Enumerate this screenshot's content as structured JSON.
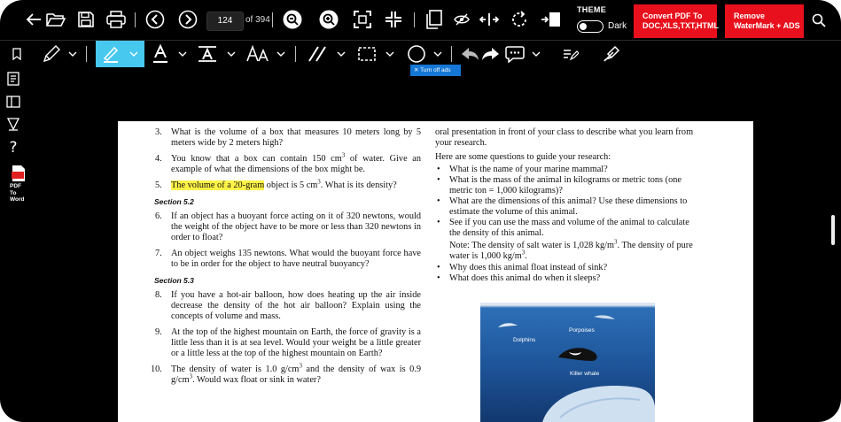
{
  "toolbar": {
    "page_current": "124",
    "page_total_label": "of 394",
    "theme_label": "Theme",
    "dark_label": "Dark",
    "convert_btn_l1": "Convert PDF To",
    "convert_btn_l2": "DOC,XLS,TXT,HTML",
    "remove_btn_l1": "Remove",
    "remove_btn_l2": "WaterMark + ADS"
  },
  "ad_strip": {
    "close_glyph": "✕",
    "label": "Turn off ads"
  },
  "sidebar": {
    "pdf_word_l1": "PDF",
    "pdf_word_l2": "To",
    "pdf_word_l3": "Word"
  },
  "document": {
    "q3_num": "3.",
    "q3_text": "What is the volume of a box that measures 10 meters long by 5 meters wide by 2 meters high?",
    "q4_num": "4.",
    "q4_a": "You know that a box can contain 150 cm",
    "q4_sup": "3",
    "q4_b": " of water. Give an example of what the dimensions of the box might be.",
    "q5_num": "5.",
    "q5_hl": "The volume of a 20-gram",
    "q5_a": " object is 5 cm",
    "q5_sup": "3",
    "q5_b": ". What is its density?",
    "sec52": "Section 5.2",
    "q6_num": "6.",
    "q6_text": "If an object has a buoyant force acting on it of 320 newtons, would the weight of the object have to be more or less than 320 newtons in order to float?",
    "q7_num": "7.",
    "q7_text": "An object weighs 135 newtons. What would the buoyant force have to be in order for the object to have neutral buoyancy?",
    "sec53": "Section 5.3",
    "q8_num": "8.",
    "q8_text": "If you have a hot-air balloon, how does heating up the air inside decrease the density of the hot air balloon? Explain using the concepts of volume and mass.",
    "q9_num": "9.",
    "q9_text": "At the top of the highest mountain on Earth, the force of gravity is a little less than it is at sea level. Would your weight be a little greater or a little less at the top of the highest mountain on Earth?",
    "q10_num": "10.",
    "q10_a": "The density of water is 1.0 g/cm",
    "q10_sup1": "3",
    "q10_b": " and the density of wax is 0.9 g/cm",
    "q10_sup2": "3",
    "q10_c": ". Would wax float or sink in water?",
    "r_intro": "oral presentation in front of your class to describe what you learn from your research.",
    "r_guide": "Here are some questions to guide your research:",
    "bullet": "•",
    "b1": "What is the name of your marine mammal?",
    "b2": "What is the mass of the animal in kilograms or metric tons (one metric ton = 1,000 kilograms)?",
    "b3": "What are the dimensions of this animal? Use these dimensions to estimate the volume of this animal.",
    "b4": "See if you can use the mass and volume of the animal to calculate the density of this animal.",
    "note_a": "Note: The density of salt water is 1,028 kg/m",
    "note_sup1": "3",
    "note_b": ". The density of pure water is 1,000 kg/m",
    "note_sup2": "3",
    "note_c": ".",
    "b5": "Why does this animal float instead of sink?",
    "b6": "What does this animal do when it sleeps?",
    "fig_porpoises": "Porpoises",
    "fig_dolphins": "Dolphins",
    "fig_killer": "Killer whale"
  }
}
